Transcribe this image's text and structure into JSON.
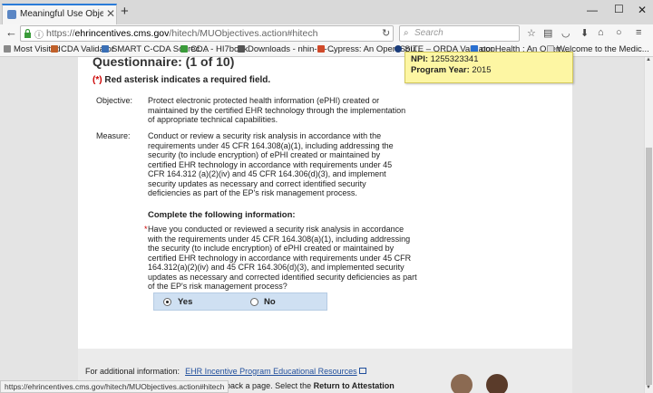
{
  "browser": {
    "tab_title": "Meaningful Use Objectives - E...",
    "url_prefix": "https://",
    "url_domain": "ehrincentives.cms.gov",
    "url_path": "/hitech/MUObjectives.action#hitech",
    "search_placeholder": "Search",
    "status_url": "https://ehrincentives.cms.gov/hitech/MUObjectives.action#hitech"
  },
  "bookmarks": [
    {
      "label": "Most Visited",
      "color": "#8a8a8a"
    },
    {
      "label": "CDA Validator",
      "color": "#c0602a"
    },
    {
      "label": "SMART C-CDA Scorec...",
      "color": "#3a6fb5"
    },
    {
      "label": "CDA - HI7book",
      "color": "#3a9b3a"
    },
    {
      "label": "Downloads - nhin-d - ...",
      "color": "#555555"
    },
    {
      "label": "Cypress: An Open Sou...",
      "color": "#d04a2a"
    },
    {
      "label": "SITE – QRDA Validator",
      "color": "#1a3c7a"
    },
    {
      "label": "popHealth : An Open ...",
      "color": "#2a6fd0"
    },
    {
      "label": "Welcome to the Medic...",
      "color": "#e0e0e0"
    }
  ],
  "provider": {
    "npi_label": "NPI:",
    "npi_value": "1255323341",
    "year_label": "Program Year:",
    "year_value": "2015"
  },
  "questionnaire": {
    "title": "Questionnaire: (1 of 10)",
    "required_asterisk": "(*)",
    "required_note": " Red asterisk indicates a required field.",
    "objective_label": "Objective:",
    "objective_text": "Protect electronic protected health information (ePHI) created or maintained by the certified EHR technology through the implementation of appropriate technical capabilities.",
    "measure_label": "Measure:",
    "measure_text": "Conduct or review a security risk analysis in accordance with the requirements under 45 CFR 164.308(a)(1), including addressing the security (to include encryption) of ePHI created or maintained by certified EHR technology in accordance with requirements under 45 CFR 164.312 (a)(2)(iv) and 45 CFR 164.306(d)(3), and implement security updates as necessary and correct identified security deficiencies as part of the EP's risk management process.",
    "complete_heading": "Complete the following information:",
    "question_star": "*",
    "question_text": "Have you conducted or reviewed a security risk analysis in accordance with the requirements under 45 CFR 164.308(a)(1), including addressing the security (to include encryption) of ePHI created or maintained by certified EHR technology in accordance with requirements under 45 CFR 164.312(a)(2)(iv) and 45 CFR 164.306(d)(3), and implemented security updates as necessary and corrected identified security deficiencies as part of the EP's risk management process?",
    "options": [
      {
        "label": "Yes",
        "selected": true
      },
      {
        "label": "No",
        "selected": false
      }
    ]
  },
  "footer": {
    "additional_info_label": "For additional information:",
    "resources_link": "EHR Incentive Program Educational Resources",
    "back_text_pre": "utton to go back a page. Select the ",
    "back_text_bold": "Return to Attestation"
  }
}
